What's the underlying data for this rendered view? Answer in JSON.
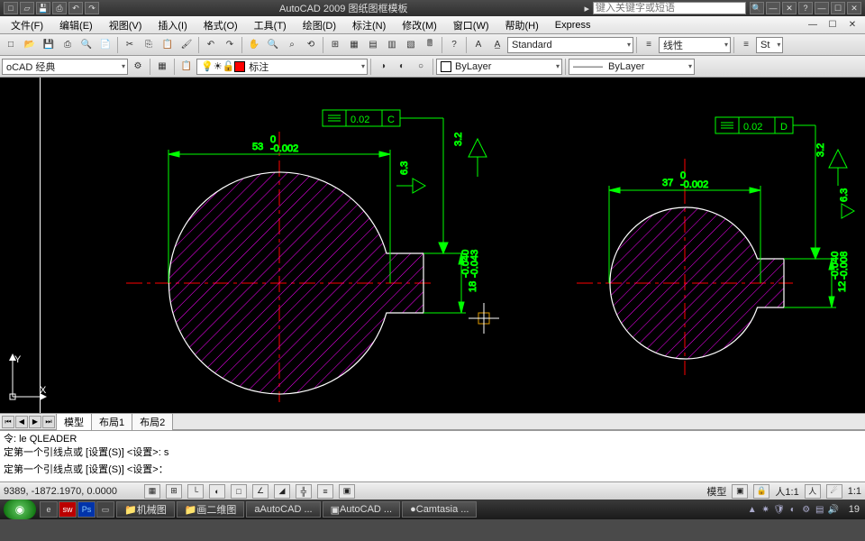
{
  "app": {
    "title": "AutoCAD 2009  图纸图框模板",
    "search_placeholder": "键入关键字或短语"
  },
  "menu": [
    "文件(F)",
    "编辑(E)",
    "视图(V)",
    "插入(I)",
    "格式(O)",
    "工具(T)",
    "绘图(D)",
    "标注(N)",
    "修改(M)",
    "窗口(W)",
    "帮助(H)",
    "Express"
  ],
  "toolbars": {
    "workspace": "oCAD 经典",
    "annotation": "标注",
    "textstyle": "Standard",
    "linetype": "线性",
    "std2": "St",
    "layer": "ByLayer",
    "linetype2": "ByLayer"
  },
  "drawing": {
    "left": {
      "fcf_tol": "0.02",
      "fcf_datum": "C",
      "diam": "53",
      "diam_sup": "0",
      "diam_sub": "-0.002",
      "ra1": "3.2",
      "ra2": "6.3",
      "key_h": "18",
      "key_sup": "-0.040",
      "key_sub": "-0.043"
    },
    "right": {
      "fcf_tol": "0.02",
      "fcf_datum": "D",
      "diam": "37",
      "diam_sup": "0",
      "diam_sub": "-0.002",
      "ra1": "3.2",
      "ra2": "6.3",
      "key_h": "12",
      "key_sup": "-0.040",
      "key_sub": "-0.008"
    },
    "axes": {
      "y": "Y",
      "x": "X"
    }
  },
  "tabs": {
    "model": "模型",
    "layout1": "布局1",
    "layout2": "布局2"
  },
  "command": {
    "line1": "令:  le QLEADER",
    "line2": "定第一个引线点或 [设置(S)] <设置>: s",
    "line3": "定第一个引线点或 [设置(S)] <设置>："
  },
  "status": {
    "coords": "9389, -1872.1970,  0.0000",
    "scale": "模型",
    "annoscale": "人1:1",
    "ratio": "1:1"
  },
  "taskbar": {
    "items": [
      "机械图",
      "画二维图",
      "AutoCAD ...",
      "AutoCAD ...",
      "Camtasia ..."
    ],
    "time": "19"
  }
}
